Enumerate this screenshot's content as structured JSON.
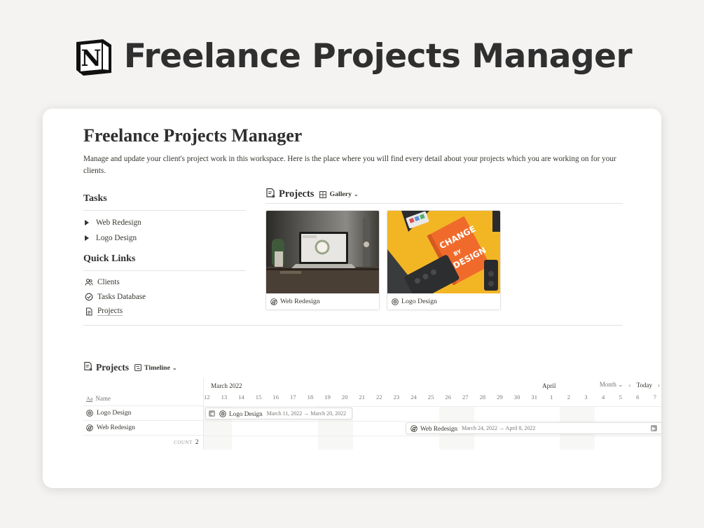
{
  "hero": {
    "title": "Freelance Projects Manager",
    "logo_letter": "N"
  },
  "page": {
    "title": "Freelance Projects Manager",
    "description": "Manage and update your client's project work in this workspace. Here is the place where you will find every detail about your projects which you are working on for your clients."
  },
  "tasks": {
    "heading": "Tasks",
    "items": [
      {
        "label": "Web Redesign"
      },
      {
        "label": "Logo Design"
      }
    ]
  },
  "quick_links": {
    "heading": "Quick Links",
    "items": [
      {
        "label": "Clients",
        "icon": "people-icon"
      },
      {
        "label": "Tasks Database",
        "icon": "check-circle-icon"
      },
      {
        "label": "Projects",
        "icon": "document-icon"
      }
    ]
  },
  "gallery": {
    "title": "Projects",
    "view": "Gallery",
    "cards": [
      {
        "label": "Web Redesign",
        "icon": "chrome-icon",
        "image": "laptop-desk-photo"
      },
      {
        "label": "Logo Design",
        "icon": "target-icon",
        "image": "change-by-design-book-photo"
      }
    ]
  },
  "timeline": {
    "title": "Projects",
    "view": "Timeline",
    "name_header": "Name",
    "months": {
      "first": "March 2022",
      "second": "April"
    },
    "controls": {
      "scale": "Month",
      "today": "Today"
    },
    "days": [
      "12",
      "13",
      "14",
      "15",
      "16",
      "17",
      "18",
      "19",
      "20",
      "21",
      "22",
      "23",
      "24",
      "25",
      "26",
      "27",
      "28",
      "29",
      "30",
      "31",
      "1",
      "2",
      "3",
      "4",
      "5",
      "6",
      "7"
    ],
    "rows": [
      {
        "name": "Logo Design",
        "icon": "target-icon",
        "range": "March 11, 2022 → March 20, 2022"
      },
      {
        "name": "Web Redesign",
        "icon": "chrome-icon",
        "range": "March 24, 2022 → April 8, 2022"
      }
    ],
    "count_label": "COUNT",
    "count_value": "2"
  }
}
